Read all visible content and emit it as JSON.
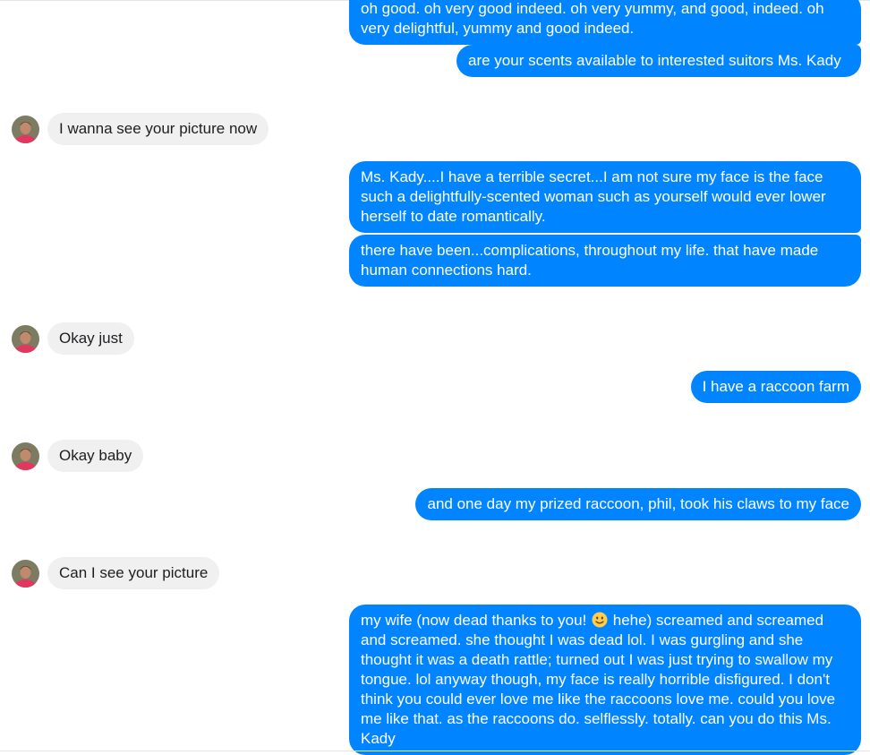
{
  "conversation": {
    "outgoing_color": "#0084ff",
    "incoming_color": "#f0f0f0",
    "messages": [
      {
        "direction": "out",
        "text": "oh good. oh very good indeed. oh very yummy, and good, indeed. oh very delightful, yummy and good indeed."
      },
      {
        "direction": "out",
        "text": "are your scents available to interested suitors Ms. Kady"
      },
      {
        "direction": "in",
        "text": "I wanna see your picture now"
      },
      {
        "direction": "out",
        "text": "Ms. Kady....I have a terrible secret...I am not sure my face is the face such a delightfully-scented woman such as yourself would ever lower herself to date romantically."
      },
      {
        "direction": "out",
        "text": "there have been...complications, throughout my life. that have made human connections hard."
      },
      {
        "direction": "in",
        "text": "Okay just"
      },
      {
        "direction": "out",
        "text": "I have a raccoon farm"
      },
      {
        "direction": "in",
        "text": "Okay baby"
      },
      {
        "direction": "out",
        "text": "and one day my prized raccoon, phil, took his claws to my face"
      },
      {
        "direction": "in",
        "text": "Can I see your picture"
      },
      {
        "direction": "out",
        "text_before_emoji": "my wife (now dead thanks to you!",
        "emoji": "slightly-smiling-face-emoji",
        "text_after_emoji": "hehe) screamed and screamed and screamed. she thought I was dead lol. I was gurgling and she thought it was a death rattle; turned out I was just trying to swallow my tongue. lol anyway though, my face is really horrible disfigured. I don't think you could ever love me like the raccoons love me. could you love me like that. as the raccoons do. selflessly. totally. can you do this Ms. Kady"
      }
    ]
  }
}
